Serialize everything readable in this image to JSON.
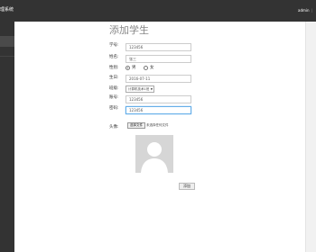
{
  "header": {
    "brand": "理系统",
    "user": "admin",
    "user_separator": "|"
  },
  "form": {
    "title": "添加学生",
    "student_id": {
      "label": "学号:",
      "value": "123456"
    },
    "name": {
      "label": "姓名:",
      "value": "张三"
    },
    "gender": {
      "label": "性别:",
      "options": [
        "男",
        "女"
      ],
      "selected": "男"
    },
    "birthday": {
      "label": "生日:",
      "value": "2016-07-11"
    },
    "class": {
      "label": "班级:",
      "selected": "计算机技术1班"
    },
    "account": {
      "label": "账号:",
      "value": "123456"
    },
    "password": {
      "label": "密码:",
      "value": "123456"
    },
    "avatar": {
      "label": "头像:",
      "file_button": "选择文件",
      "file_status": "未选择任何文件"
    },
    "submit_label": "添加"
  }
}
